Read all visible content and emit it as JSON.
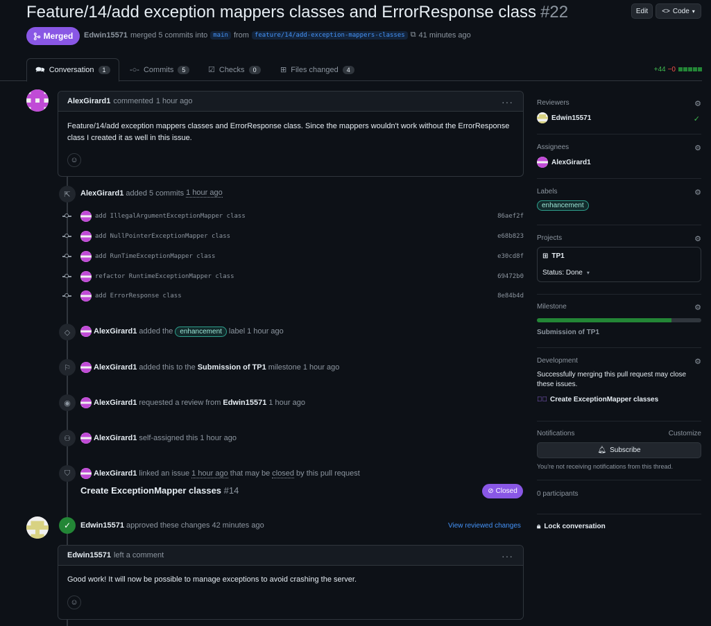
{
  "header": {
    "title": "Feature/14/add exception mappers classes and ErrorResponse class",
    "number": "#22",
    "edit_label": "Edit",
    "code_label": "Code",
    "state_label": "Merged",
    "author": "Edwin15571",
    "merged_text": "merged 5 commits into",
    "base_branch": "main",
    "from_text": "from",
    "head_branch": "feature/14/add-exception-mappers-classes",
    "time": "41 minutes ago"
  },
  "tabs": [
    {
      "label": "Conversation",
      "count": "1",
      "active": true
    },
    {
      "label": "Commits",
      "count": "5"
    },
    {
      "label": "Checks",
      "count": "0"
    },
    {
      "label": "Files changed",
      "count": "4"
    }
  ],
  "diffstat": {
    "additions": "+44",
    "deletions": "−0"
  },
  "comment1": {
    "author": "AlexGirard1",
    "action": "commented",
    "time": "1 hour ago",
    "body": "Feature/14/add exception mappers classes and ErrorResponse class. Since the mappers wouldn't work without the ErrorResponse class I created it as well in this issue."
  },
  "commits_event": {
    "author": "AlexGirard1",
    "action": "added 5 commits",
    "time": "1 hour ago"
  },
  "commits": [
    {
      "msg": "add IllegalArgumentExceptionMapper class",
      "sha": "86aef2f"
    },
    {
      "msg": "add NullPointerExceptionMapper class",
      "sha": "e68b823"
    },
    {
      "msg": "add RunTimeExceptionMapper class",
      "sha": "e30cd8f"
    },
    {
      "msg": "refactor RuntimeExceptionMapper class",
      "sha": "69472b0"
    },
    {
      "msg": "add ErrorResponse class",
      "sha": "8e84b4d"
    }
  ],
  "events": {
    "label": {
      "author": "AlexGirard1",
      "pre": "added the",
      "label": "enhancement",
      "post": "label",
      "time": "1 hour ago"
    },
    "milestone": {
      "author": "AlexGirard1",
      "pre": "added this to the",
      "name": "Submission of TP1",
      "post": "milestone",
      "time": "1 hour ago"
    },
    "review": {
      "author": "AlexGirard1",
      "pre": "requested a review from",
      "name": "Edwin15571",
      "time": "1 hour ago"
    },
    "assign": {
      "author": "AlexGirard1",
      "pre": "self-assigned this",
      "time": "1 hour ago"
    },
    "link": {
      "author": "AlexGirard1",
      "pre": "linked an issue",
      "time": "1 hour ago",
      "mid": "that may be",
      "closed": "closed",
      "post": "by this pull request",
      "issue_title": "Create ExceptionMapper classes",
      "issue_num": "#14",
      "issue_state": "Closed"
    }
  },
  "approval": {
    "author": "Edwin15571",
    "text": "approved these changes",
    "time": "42 minutes ago",
    "view_link": "View reviewed changes"
  },
  "comment2": {
    "author": "Edwin15571",
    "action": "left a comment",
    "body": "Good work! It will now be possible to manage exceptions to avoid crashing the server."
  },
  "sidebar": {
    "reviewers_title": "Reviewers",
    "reviewer": "Edwin15571",
    "assignees_title": "Assignees",
    "assignee": "AlexGirard1",
    "labels_title": "Labels",
    "label": "enhancement",
    "projects_title": "Projects",
    "project_name": "TP1",
    "project_status": "Status: Done",
    "milestone_title": "Milestone",
    "milestone_name": "Submission of TP1",
    "milestone_progress": 0.82,
    "development_title": "Development",
    "development_text": "Successfully merging this pull request may close these issues.",
    "development_issue": "Create ExceptionMapper classes",
    "notifications_title": "Notifications",
    "customize": "Customize",
    "subscribe": "Subscribe",
    "notif_text": "You're not receiving notifications from this thread.",
    "participants": "0 participants",
    "lock": "Lock conversation"
  },
  "colors": {
    "merged": "#8957e5",
    "green": "#238636",
    "link": "#4493f8",
    "red": "#f85149",
    "add": "#3fb950"
  }
}
